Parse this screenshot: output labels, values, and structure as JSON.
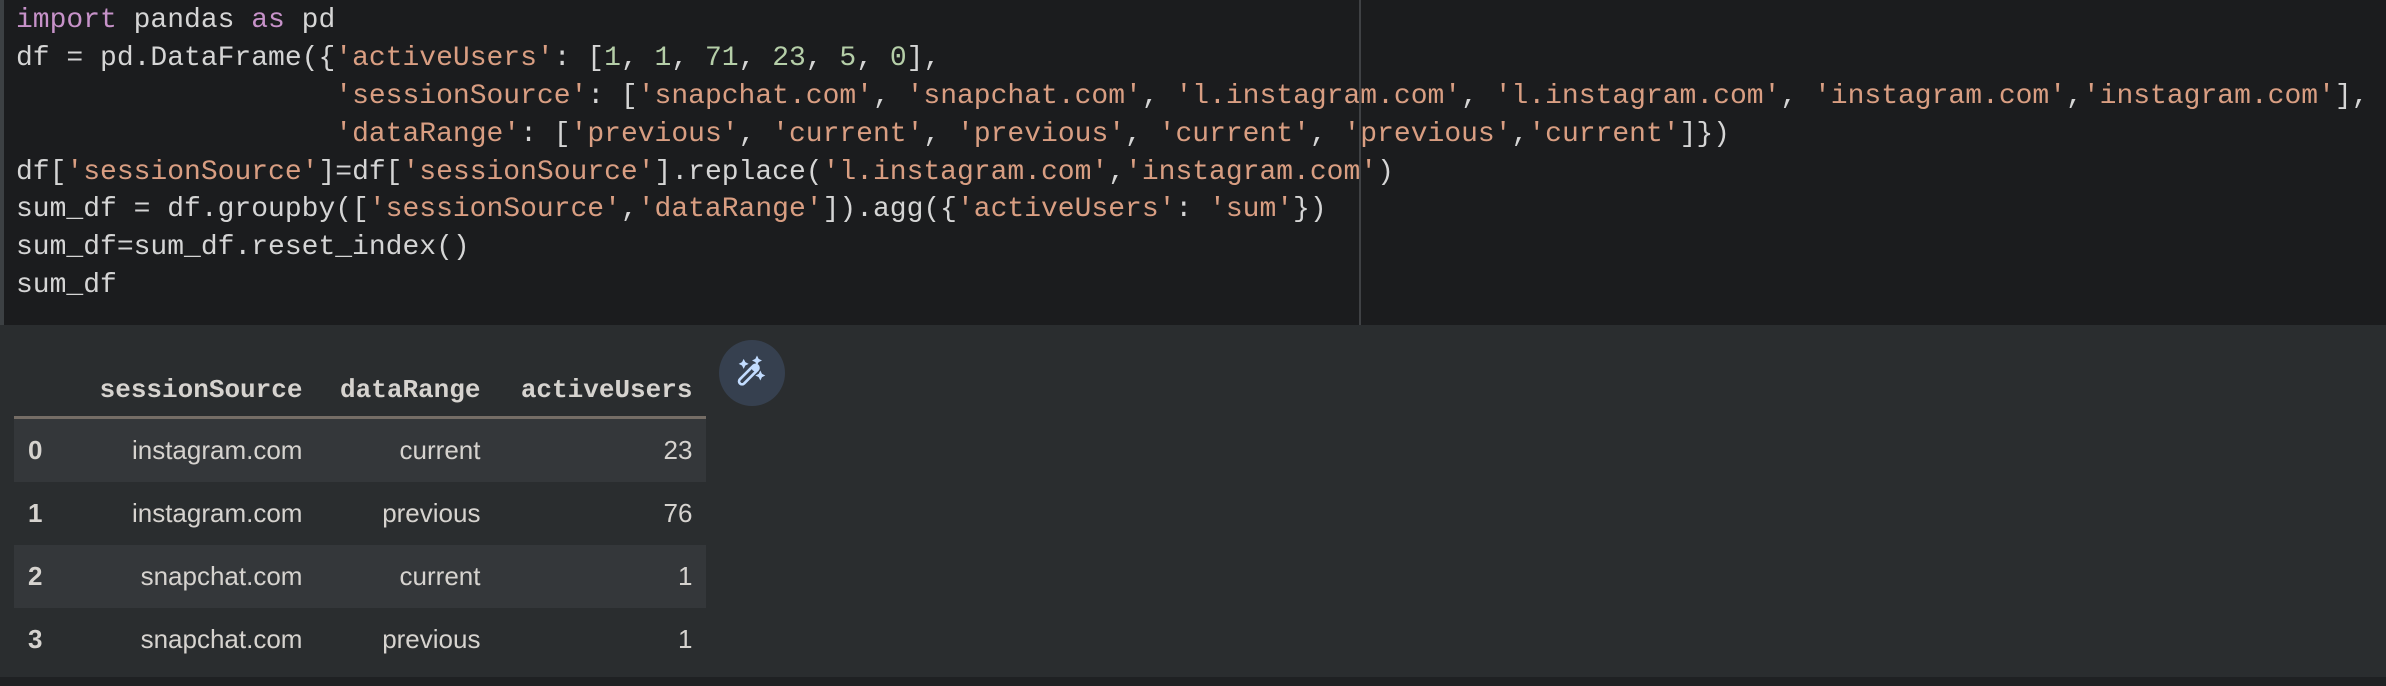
{
  "code_cell": {
    "lines": [
      [
        {
          "t": "kw",
          "v": "import"
        },
        {
          "t": "pl",
          "v": " pandas "
        },
        {
          "t": "kw",
          "v": "as"
        },
        {
          "t": "pl",
          "v": " pd"
        }
      ],
      [
        {
          "t": "pl",
          "v": "df = pd.DataFrame({"
        },
        {
          "t": "str",
          "v": "'activeUsers'"
        },
        {
          "t": "pl",
          "v": ": ["
        },
        {
          "t": "num",
          "v": "1"
        },
        {
          "t": "pl",
          "v": ", "
        },
        {
          "t": "num",
          "v": "1"
        },
        {
          "t": "pl",
          "v": ", "
        },
        {
          "t": "num",
          "v": "71"
        },
        {
          "t": "pl",
          "v": ", "
        },
        {
          "t": "num",
          "v": "23"
        },
        {
          "t": "pl",
          "v": ", "
        },
        {
          "t": "num",
          "v": "5"
        },
        {
          "t": "pl",
          "v": ", "
        },
        {
          "t": "num",
          "v": "0"
        },
        {
          "t": "pl",
          "v": "],"
        }
      ],
      [
        {
          "t": "pl",
          "v": "                   "
        },
        {
          "t": "str",
          "v": "'sessionSource'"
        },
        {
          "t": "pl",
          "v": ": ["
        },
        {
          "t": "str",
          "v": "'snapchat.com'"
        },
        {
          "t": "pl",
          "v": ", "
        },
        {
          "t": "str",
          "v": "'snapchat.com'"
        },
        {
          "t": "pl",
          "v": ", "
        },
        {
          "t": "str",
          "v": "'l.instagram.com'"
        },
        {
          "t": "pl",
          "v": ", "
        },
        {
          "t": "str",
          "v": "'l.instagram.com'"
        },
        {
          "t": "pl",
          "v": ", "
        },
        {
          "t": "str",
          "v": "'instagram.com'"
        },
        {
          "t": "pl",
          "v": ","
        },
        {
          "t": "str",
          "v": "'instagram.com'"
        },
        {
          "t": "pl",
          "v": "],"
        }
      ],
      [
        {
          "t": "pl",
          "v": "                   "
        },
        {
          "t": "str",
          "v": "'dataRange'"
        },
        {
          "t": "pl",
          "v": ": ["
        },
        {
          "t": "str",
          "v": "'previous'"
        },
        {
          "t": "pl",
          "v": ", "
        },
        {
          "t": "str",
          "v": "'current'"
        },
        {
          "t": "pl",
          "v": ", "
        },
        {
          "t": "str",
          "v": "'previous'"
        },
        {
          "t": "pl",
          "v": ", "
        },
        {
          "t": "str",
          "v": "'current'"
        },
        {
          "t": "pl",
          "v": ", "
        },
        {
          "t": "str",
          "v": "'previous'"
        },
        {
          "t": "pl",
          "v": ","
        },
        {
          "t": "str",
          "v": "'current'"
        },
        {
          "t": "pl",
          "v": "]})"
        }
      ],
      [
        {
          "t": "pl",
          "v": "df["
        },
        {
          "t": "str",
          "v": "'sessionSource'"
        },
        {
          "t": "pl",
          "v": "]=df["
        },
        {
          "t": "str",
          "v": "'sessionSource'"
        },
        {
          "t": "pl",
          "v": "].replace("
        },
        {
          "t": "str",
          "v": "'l.instagram.com'"
        },
        {
          "t": "pl",
          "v": ","
        },
        {
          "t": "str",
          "v": "'instagram.com'"
        },
        {
          "t": "pl",
          "v": ")"
        }
      ],
      [
        {
          "t": "pl",
          "v": "sum_df = df.groupby(["
        },
        {
          "t": "str",
          "v": "'sessionSource'"
        },
        {
          "t": "pl",
          "v": ","
        },
        {
          "t": "str",
          "v": "'dataRange'"
        },
        {
          "t": "pl",
          "v": "]).agg({"
        },
        {
          "t": "str",
          "v": "'activeUsers'"
        },
        {
          "t": "pl",
          "v": ": "
        },
        {
          "t": "str",
          "v": "'sum'"
        },
        {
          "t": "pl",
          "v": "})"
        }
      ],
      [
        {
          "t": "pl",
          "v": "sum_df=sum_df.reset_index()"
        }
      ],
      [
        {
          "t": "pl",
          "v": "sum_df"
        }
      ]
    ]
  },
  "output": {
    "table": {
      "columns": [
        "",
        "sessionSource",
        "dataRange",
        "activeUsers"
      ],
      "rows": [
        {
          "index": "0",
          "sessionSource": "instagram.com",
          "dataRange": "current",
          "activeUsers": "23"
        },
        {
          "index": "1",
          "sessionSource": "instagram.com",
          "dataRange": "previous",
          "activeUsers": "76"
        },
        {
          "index": "2",
          "sessionSource": "snapchat.com",
          "dataRange": "current",
          "activeUsers": "1"
        },
        {
          "index": "3",
          "sessionSource": "snapchat.com",
          "dataRange": "previous",
          "activeUsers": "1"
        }
      ]
    },
    "suggest_button": {
      "icon": "magic-wand-icon"
    }
  },
  "colors": {
    "keyword": "#c792c9",
    "string": "#d99e82",
    "number": "#b5cea8",
    "plain": "#d5d5d5",
    "wand_icon": "#c2dcff"
  }
}
